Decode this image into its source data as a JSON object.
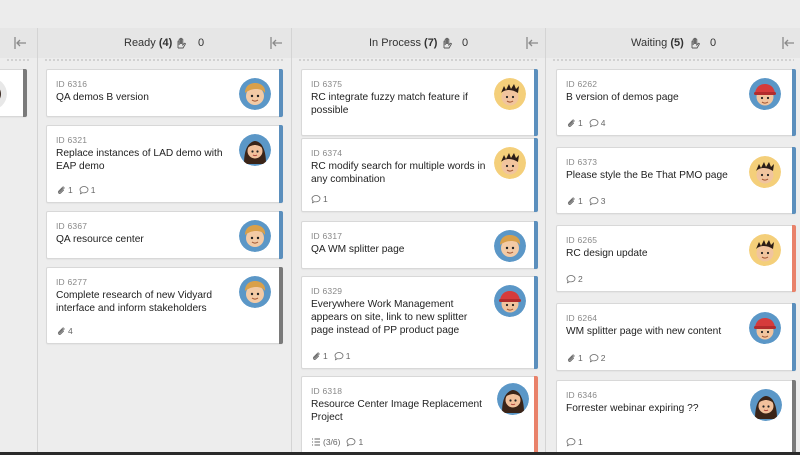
{
  "colors": {
    "blue": "#5b8fbd",
    "gray": "#7a7a7a",
    "orange": "#e9826a"
  },
  "lanes": [
    {
      "label": "Ready",
      "count": "(4)",
      "handoffs": "0"
    },
    {
      "label": "In Process",
      "count": "(7)",
      "handoffs": "0"
    },
    {
      "label": "Waiting",
      "count": "(5)",
      "handoffs": "0"
    }
  ],
  "cards": [
    {
      "id": "ID 6316",
      "title": "QA demos B version",
      "attachments": "",
      "comments": "",
      "checklist": "",
      "avatar": "boy-blonde",
      "bar": "blue"
    },
    {
      "id": "ID 6321",
      "title": "Replace instances of LAD demo with EAP demo",
      "attachments": "1",
      "comments": "1",
      "checklist": "",
      "avatar": "girl-dark",
      "bar": "blue"
    },
    {
      "id": "ID 6367",
      "title": "QA resource center",
      "attachments": "",
      "comments": "",
      "checklist": "",
      "avatar": "boy-blonde",
      "bar": "blue"
    },
    {
      "id": "ID 6277",
      "title": "Complete research of new Vidyard interface and inform stakeholders",
      "attachments": "4",
      "comments": "",
      "checklist": "",
      "avatar": "boy-blonde",
      "bar": "gray"
    },
    {
      "id": "ID 6375",
      "title": "RC integrate fuzzy match feature if possible",
      "attachments": "",
      "comments": "",
      "checklist": "",
      "avatar": "boy-spiky",
      "bar": "blue"
    },
    {
      "id": "ID 6374",
      "title": "RC modify search for multiple words in any combination",
      "attachments": "",
      "comments": "1",
      "checklist": "",
      "avatar": "boy-spiky",
      "bar": "blue"
    },
    {
      "id": "ID 6317",
      "title": "QA WM splitter page",
      "attachments": "",
      "comments": "",
      "checklist": "",
      "avatar": "boy-blonde",
      "bar": "blue"
    },
    {
      "id": "ID 6329",
      "title": "Everywhere Work Management appears on site, link to new splitter page instead of PP product page",
      "attachments": "1",
      "comments": "1",
      "checklist": "",
      "avatar": "boy-cap",
      "bar": "blue"
    },
    {
      "id": "ID 6318",
      "title": "Resource Center Image Replacement Project",
      "attachments": "",
      "comments": "1",
      "checklist": "(3/6)",
      "avatar": "girl-dark",
      "bar": "orange"
    },
    {
      "id": "ID 6262",
      "title": "B version of demos page",
      "attachments": "1",
      "comments": "4",
      "checklist": "",
      "avatar": "boy-cap",
      "bar": "blue"
    },
    {
      "id": "ID 6373",
      "title": "Please style the Be That PMO page",
      "attachments": "1",
      "comments": "3",
      "checklist": "",
      "avatar": "boy-spiky",
      "bar": "blue"
    },
    {
      "id": "ID 6265",
      "title": "RC design update",
      "attachments": "",
      "comments": "2",
      "checklist": "",
      "avatar": "boy-spiky",
      "bar": "orange"
    },
    {
      "id": "ID 6264",
      "title": "WM splitter page with new content",
      "attachments": "1",
      "comments": "2",
      "checklist": "",
      "avatar": "boy-cap",
      "bar": "blue"
    },
    {
      "id": "ID 6346",
      "title": "Forrester webinar expiring ??",
      "attachments": "",
      "comments": "1",
      "checklist": "",
      "avatar": "girl-dark",
      "bar": "gray"
    }
  ]
}
